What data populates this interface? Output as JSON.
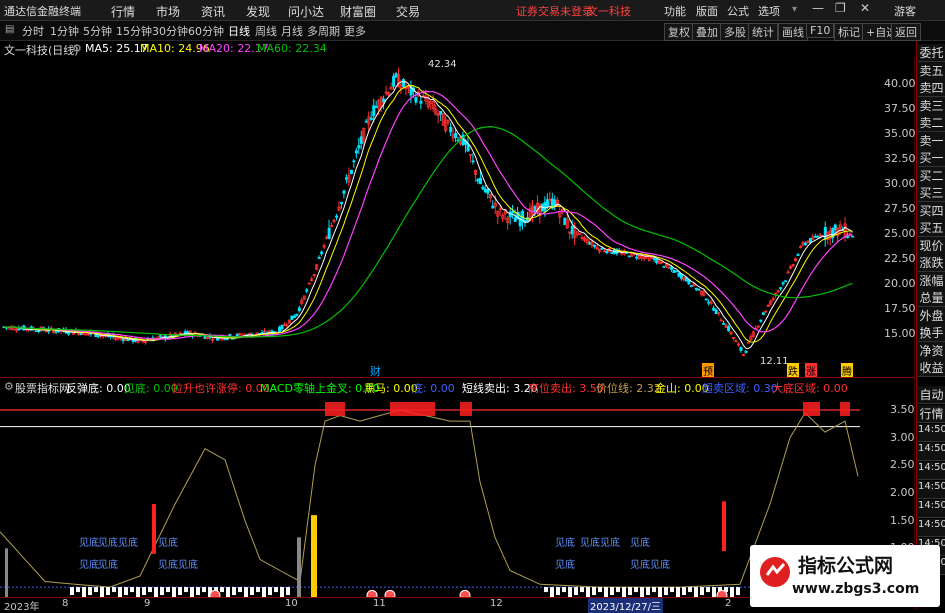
{
  "menubar": {
    "app_title": "通达信金融终端",
    "items": [
      "行情",
      "市场",
      "资讯",
      "发现",
      "问小达",
      "财富圈",
      "交易"
    ],
    "warning": "证券交易未登录",
    "stock_title": "文一科技",
    "right_items": [
      "功能",
      "版面",
      "公式",
      "选项"
    ],
    "guest": "游客"
  },
  "periodbar": {
    "periods": [
      "分时",
      "1分钟",
      "5分钟",
      "15分钟",
      "30分钟",
      "60分钟",
      "日线",
      "周线",
      "月线",
      "多周期",
      "更多"
    ],
    "active": "日线",
    "tools": [
      "复权",
      "叠加",
      "多股",
      "统计",
      "画线",
      "F10",
      "标记",
      "+自选",
      "返回"
    ]
  },
  "infoline": {
    "title": "文一科技(日线)",
    "ma5": "MA5: 25.17",
    "ma10": "MA10: 24.96",
    "ma20": "MA20: 22.17",
    "ma60": "MA60: 22.34"
  },
  "right_panel_top": [
    "委托",
    "卖五",
    "卖四",
    "卖三",
    "卖二",
    "卖一",
    "买一",
    "买二",
    "买三",
    "买四",
    "买五",
    "现价",
    "涨跌",
    "涨幅",
    "总量",
    "外盘",
    "换手",
    "净资",
    "收益"
  ],
  "right_panel_bottom": [
    "自动",
    "行情",
    "14:50",
    "14:50",
    "14:50",
    "14:50",
    "14:50",
    "14:50",
    "14:50",
    "14:50"
  ],
  "main_axis": [
    "40.00",
    "37.50",
    "35.00",
    "32.50",
    "30.00",
    "27.50",
    "25.00",
    "22.50",
    "20.00",
    "17.50",
    "15.00"
  ],
  "main_annotations": {
    "high": "42.34",
    "low": "12.11"
  },
  "main_markers": [
    {
      "text": "财",
      "color": "#00aaff"
    },
    {
      "text": "预",
      "color": "#ff9900"
    },
    {
      "text": "跌",
      "color": "#ffcc00"
    },
    {
      "text": "涨",
      "color": "#ff3030"
    },
    {
      "text": "腾",
      "color": "#ffcc00"
    }
  ],
  "indicator": {
    "name": "股票指标网",
    "params": [
      {
        "text": "反弹底: 0.00",
        "color": "#ffffff"
      },
      {
        "text": "见底: 0.00",
        "color": "#00c000"
      },
      {
        "text": "拉升也许涨停: 0.00",
        "color": "#ff3030"
      },
      {
        "text": "MACD零轴上金叉: 0.00",
        "color": "#00ff00"
      },
      {
        "text": "黑马: 0.00",
        "color": "#ffff00"
      },
      {
        "text": "底: 0.00",
        "color": "#4060ff"
      },
      {
        "text": "短线卖出: 3.20",
        "color": "#ffffff"
      },
      {
        "text": "高位卖出: 3.50",
        "color": "#ff3030"
      },
      {
        "text": "价位线: 2.32",
        "color": "#c8a050"
      },
      {
        "text": "金山: 0.00",
        "color": "#ffff00"
      },
      {
        "text": "超卖区域: 0.30",
        "color": "#4060ff"
      },
      {
        "text": "大底区域: 0.00",
        "color": "#ff3030"
      }
    ],
    "axis": [
      "3.50",
      "3.00",
      "2.50",
      "2.00",
      "1.50",
      "1.00",
      "0.50"
    ],
    "signals": [
      "见底",
      "见底见底",
      "见底",
      "见底",
      "见底",
      "见底",
      "见底见底",
      "见底",
      "见底",
      "见底见底",
      "见底见底"
    ]
  },
  "datebar": [
    "2023年",
    "8",
    "9",
    "10",
    "11",
    "12",
    "2023/12/27/三",
    "2"
  ],
  "watermark": {
    "line1": "指标公式网",
    "line2": "www.zbgs3.com"
  },
  "colors": {
    "up": "#ff3030",
    "down": "#00e5ff",
    "ma5": "#ffffff",
    "ma10": "#ffff00",
    "ma20": "#ff40ff",
    "ma60": "#00c000",
    "axis": "#8a0000"
  }
}
